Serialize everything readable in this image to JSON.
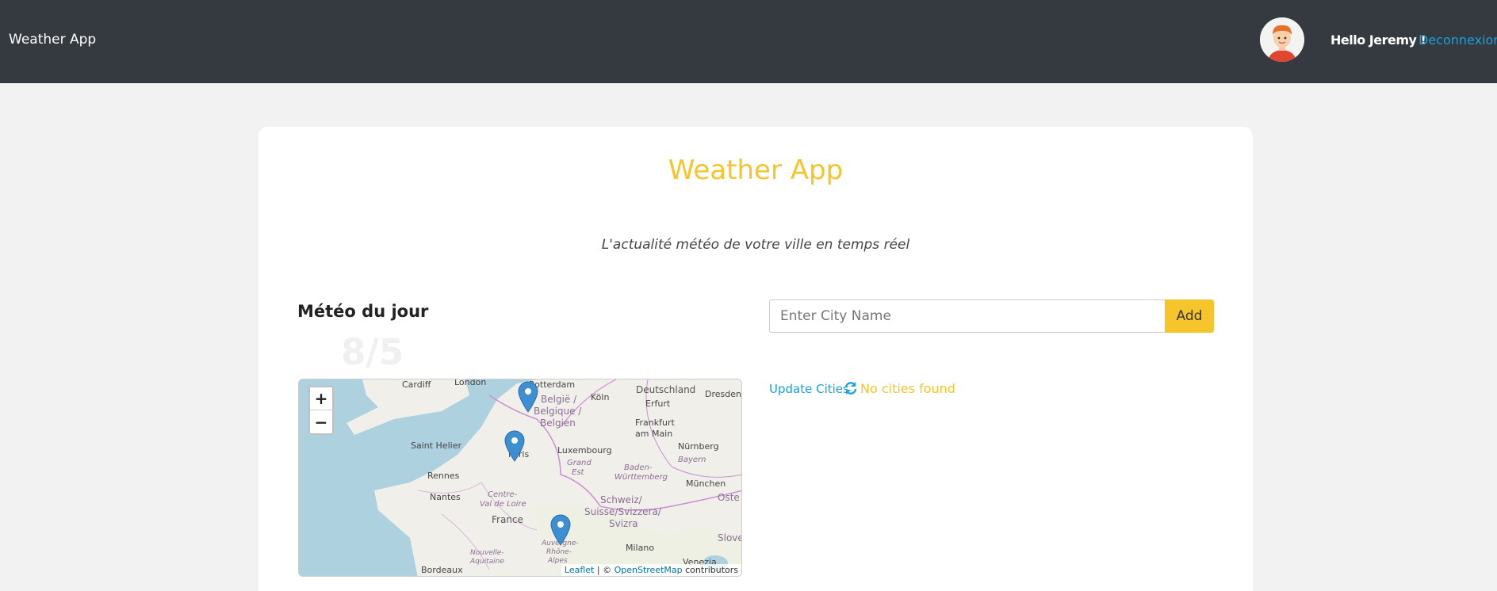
{
  "navbar": {
    "brand": "Weather App",
    "greeting": "Hello Jeremy !",
    "logout": "Deconnexion"
  },
  "main": {
    "title": "Weather App",
    "tagline": "L'actualité météo de votre ville en temps réel",
    "meteo_title": "Météo du jour",
    "date": "8/5"
  },
  "map": {
    "zoom_in": "+",
    "zoom_out": "−",
    "attribution_leaflet": "Leaflet",
    "attribution_sep": " | © ",
    "attribution_osm": "OpenStreetMap",
    "attribution_suffix": " contributors",
    "labels": [
      "Cardiff",
      "London",
      "Rotterdam",
      "Deutschland",
      "Dresden",
      "Köln",
      "België /",
      "Belgique /",
      "Belgien",
      "Erfurt",
      "Frankfurt",
      "am Main",
      "Saint Helier",
      "Paris",
      "Luxembourg",
      "Nürnberg",
      "Grand",
      "Est",
      "Bayern",
      "Baden-",
      "Württemberg",
      "Rennes",
      "München",
      "Nantes",
      "Centre-",
      "Val de Loire",
      "Schweiz/",
      "Suisse/Svizzera/",
      "Svizra",
      "Oste",
      "France",
      "Auvergne-",
      "Rhône-",
      "Alpes",
      "Milano",
      "Slove",
      "Nouvelle-",
      "Aquitaine",
      "Bordeaux",
      "Venezia"
    ]
  },
  "form": {
    "placeholder": "Enter City Name",
    "add_label": "Add"
  },
  "cities": {
    "update_label": "Update Cities",
    "empty_message": "No cities found"
  },
  "colors": {
    "navbar": "#343a40",
    "accent": "#f5c52b",
    "link": "#17a2e0"
  }
}
